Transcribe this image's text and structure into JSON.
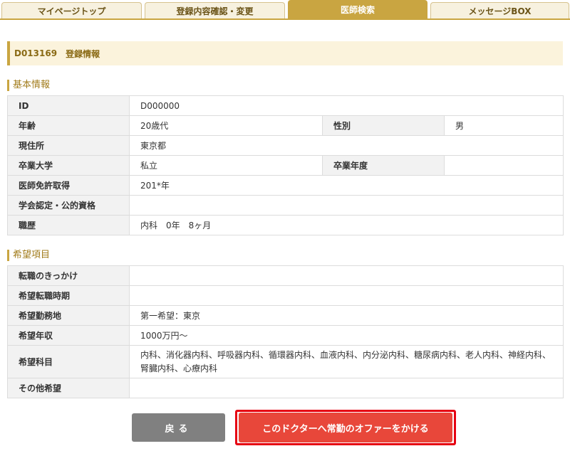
{
  "tabs": [
    {
      "label": "マイページトップ"
    },
    {
      "label": "登録内容確認・変更"
    },
    {
      "label": "医師検索"
    },
    {
      "label": "メッセージBOX"
    }
  ],
  "header": {
    "id": "D013169",
    "title": "登録情報"
  },
  "basic": {
    "section_title": "基本情報",
    "id_label": "ID",
    "id_value": "D000000",
    "age_label": "年齢",
    "age_value": "20歳代",
    "gender_label": "性別",
    "gender_value": "男",
    "address_label": "現住所",
    "address_value": "東京都",
    "university_label": "卒業大学",
    "university_value": "私立",
    "grad_year_label": "卒業年度",
    "grad_year_value": "",
    "license_label": "医師免許取得",
    "license_value": "201*年",
    "cert_label": "学会認定・公的資格",
    "cert_value": "",
    "career_label": "職歴",
    "career_value": "内科　0年　8ヶ月"
  },
  "wish": {
    "section_title": "希望項目",
    "reason_label": "転職のきっかけ",
    "reason_value": "",
    "timing_label": "希望転職時期",
    "timing_value": "",
    "location_label": "希望勤務地",
    "location_value": "第一希望：東京",
    "salary_label": "希望年収",
    "salary_value": "1000万円～",
    "dept_label": "希望科目",
    "dept_value": "内科、消化器内科、呼吸器内科、循環器内科、血液内科、内分泌内科、糖尿病内科、老人内科、神経内科、腎臓内科、心療内科",
    "other_label": "その他希望",
    "other_value": ""
  },
  "buttons": {
    "back_label": "戻る",
    "offer_label": "このドクターへ常勤のオファーをかける"
  },
  "colors": {
    "accent": "#c9a541",
    "offer": "#e8473a",
    "back": "#808080"
  }
}
